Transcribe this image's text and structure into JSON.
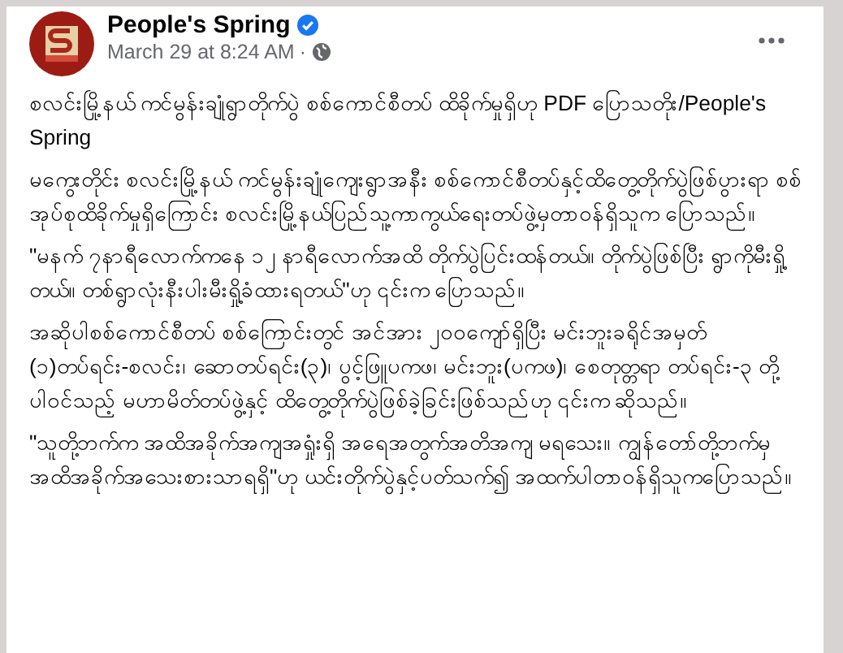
{
  "post": {
    "author": "People's Spring",
    "verified": true,
    "timestamp": "March 29 at 8:24 AM",
    "separator": "·",
    "paragraphs": [
      "စလင်းမြို့နယ် ကင်မွန်းချုံရွာတိုက်ပွဲ စစ်ကောင်စီတပ် ထိခိုက်မှုရှိဟု PDF ပြောသတိုး/People's Spring",
      "မကွေးတိုင်း စလင်းမြို့နယ် ကင်မွန်းချုံကျေးရွာအနီး စစ်ကောင်စီတပ်နှင့်ထိတွေ့တိုက်ပွဲဖြစ်ပွားရာ စစ်အုပ်စုထိခိုက်မှုရှိကြောင်း စလင်းမြို့နယ်ပြည်သူ့ကာကွယ်ရေးတပ်ဖွဲ့မှတာဝန်ရှိသူက ပြောသည်။",
      "\"မနက် ၇နာရီလောက်ကနေ ၁၂ နာရီလောက်အထိ တိုက်ပွဲပြင်းထန်တယ်။ တိုက်ပွဲဖြစ်ပြီး ရွာကိုမီးရှို့တယ်။ တစ်ရွာလုံးနီးပါးမီးရှို့ခံထားရတယ်\"ဟု ၎င်းက ပြောသည်။",
      "အဆိုပါစစ်ကောင်စီတပ် စစ်ကြောင်းတွင် အင်အား ၂၀၀ကျော်ရှိပြီး မင်းဘူးခရိုင်အမှတ် (၁)တပ်ရင်း-စလင်း၊ ဆောတပ်ရင်း(၃)၊ ပွင့်ဖြူပကဖ၊ မင်းဘူး(ပကဖ)၊ စေတုတ္တရာ တပ်ရင်း-၃ တို့ပါဝင်သည့် မဟာမိတ်တပ်ဖွဲ့နှင့် ထိတွေ့တိုက်ပွဲဖြစ်ခဲ့ခြင်းဖြစ်သည်ဟု ၎င်းက ဆိုသည်။",
      "\"သူတို့ဘက်က အထိအခိုက်အကျအရှုံးရှိ အရေအတွက်အတိအကျ မရသေး။ ကျွန်တော်တို့ဘက်မှ အထိအခိုက်အသေးစားသာရရှိ\"ဟု ယင်းတိုက်ပွဲနှင့်ပတ်သက်၍ အထက်ပါတာဝန်ရှိသူကပြောသည်။"
    ]
  }
}
